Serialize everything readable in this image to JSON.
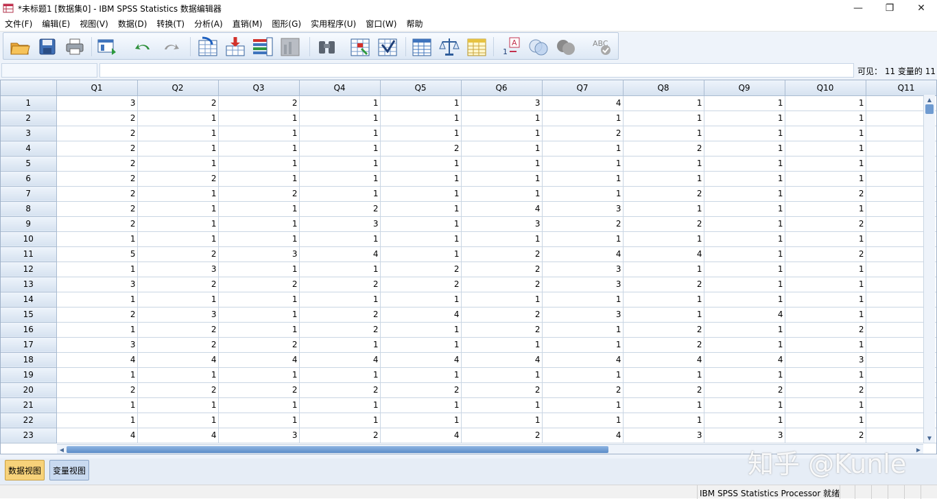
{
  "window": {
    "title": "*未标题1 [数据集0] - IBM SPSS Statistics 数据编辑器",
    "minimize": "—",
    "maximize": "❐",
    "close": "✕"
  },
  "menu": [
    "文件(F)",
    "编辑(E)",
    "视图(V)",
    "数据(D)",
    "转换(T)",
    "分析(A)",
    "直销(M)",
    "图形(G)",
    "实用程序(U)",
    "窗口(W)",
    "帮助"
  ],
  "toolbar": {
    "icons": [
      "open-icon",
      "save-icon",
      "print-icon",
      "dialog-recall-icon",
      "undo-icon",
      "redo-icon",
      "goto-case-icon",
      "goto-variable-icon",
      "variables-icon",
      "chart-builder-icon",
      "find-icon",
      "insert-cases-icon",
      "insert-variable-icon",
      "split-file-icon",
      "weight-cases-icon",
      "select-cases-icon",
      "value-labels-icon",
      "use-sets-icon",
      "show-all-variables-icon",
      "spell-check-icon"
    ]
  },
  "editrow": {
    "visible": "可见： 11 变量的 11"
  },
  "grid": {
    "columns": [
      "Q1",
      "Q2",
      "Q3",
      "Q4",
      "Q5",
      "Q6",
      "Q7",
      "Q8",
      "Q9",
      "Q10",
      "Q11"
    ],
    "rows": [
      {
        "n": "1",
        "v": [
          "3",
          "2",
          "2",
          "1",
          "1",
          "3",
          "4",
          "1",
          "1",
          "1",
          ""
        ]
      },
      {
        "n": "2",
        "v": [
          "2",
          "1",
          "1",
          "1",
          "1",
          "1",
          "1",
          "1",
          "1",
          "1",
          ""
        ]
      },
      {
        "n": "3",
        "v": [
          "2",
          "1",
          "1",
          "1",
          "1",
          "1",
          "2",
          "1",
          "1",
          "1",
          ""
        ]
      },
      {
        "n": "4",
        "v": [
          "2",
          "1",
          "1",
          "1",
          "2",
          "1",
          "1",
          "2",
          "1",
          "1",
          ""
        ]
      },
      {
        "n": "5",
        "v": [
          "2",
          "1",
          "1",
          "1",
          "1",
          "1",
          "1",
          "1",
          "1",
          "1",
          ""
        ]
      },
      {
        "n": "6",
        "v": [
          "2",
          "2",
          "1",
          "1",
          "1",
          "1",
          "1",
          "1",
          "1",
          "1",
          ""
        ]
      },
      {
        "n": "7",
        "v": [
          "2",
          "1",
          "2",
          "1",
          "1",
          "1",
          "1",
          "2",
          "1",
          "2",
          ""
        ]
      },
      {
        "n": "8",
        "v": [
          "2",
          "1",
          "1",
          "2",
          "1",
          "4",
          "3",
          "1",
          "1",
          "1",
          ""
        ]
      },
      {
        "n": "9",
        "v": [
          "2",
          "1",
          "1",
          "3",
          "1",
          "3",
          "2",
          "2",
          "1",
          "2",
          ""
        ]
      },
      {
        "n": "10",
        "v": [
          "1",
          "1",
          "1",
          "1",
          "1",
          "1",
          "1",
          "1",
          "1",
          "1",
          ""
        ]
      },
      {
        "n": "11",
        "v": [
          "5",
          "2",
          "3",
          "4",
          "1",
          "2",
          "4",
          "4",
          "1",
          "2",
          ""
        ]
      },
      {
        "n": "12",
        "v": [
          "1",
          "3",
          "1",
          "1",
          "2",
          "2",
          "3",
          "1",
          "1",
          "1",
          ""
        ]
      },
      {
        "n": "13",
        "v": [
          "3",
          "2",
          "2",
          "2",
          "2",
          "2",
          "3",
          "2",
          "1",
          "1",
          ""
        ]
      },
      {
        "n": "14",
        "v": [
          "1",
          "1",
          "1",
          "1",
          "1",
          "1",
          "1",
          "1",
          "1",
          "1",
          ""
        ]
      },
      {
        "n": "15",
        "v": [
          "2",
          "3",
          "1",
          "2",
          "4",
          "2",
          "3",
          "1",
          "4",
          "1",
          ""
        ]
      },
      {
        "n": "16",
        "v": [
          "1",
          "2",
          "1",
          "2",
          "1",
          "2",
          "1",
          "2",
          "1",
          "2",
          ""
        ]
      },
      {
        "n": "17",
        "v": [
          "3",
          "2",
          "2",
          "1",
          "1",
          "1",
          "1",
          "2",
          "1",
          "1",
          ""
        ]
      },
      {
        "n": "18",
        "v": [
          "4",
          "4",
          "4",
          "4",
          "4",
          "4",
          "4",
          "4",
          "4",
          "3",
          ""
        ]
      },
      {
        "n": "19",
        "v": [
          "1",
          "1",
          "1",
          "1",
          "1",
          "1",
          "1",
          "1",
          "1",
          "1",
          ""
        ]
      },
      {
        "n": "20",
        "v": [
          "2",
          "2",
          "2",
          "2",
          "2",
          "2",
          "2",
          "2",
          "2",
          "2",
          ""
        ]
      },
      {
        "n": "21",
        "v": [
          "1",
          "1",
          "1",
          "1",
          "1",
          "1",
          "1",
          "1",
          "1",
          "1",
          ""
        ]
      },
      {
        "n": "22",
        "v": [
          "1",
          "1",
          "1",
          "1",
          "1",
          "1",
          "1",
          "1",
          "1",
          "1",
          ""
        ]
      },
      {
        "n": "23",
        "v": [
          "4",
          "4",
          "3",
          "2",
          "4",
          "2",
          "4",
          "3",
          "3",
          "2",
          ""
        ]
      }
    ]
  },
  "tabs": {
    "data_view": "数据视图",
    "variable_view": "变量视图"
  },
  "status": {
    "processor": "IBM SPSS Statistics Processor 就绪"
  },
  "watermark": "知乎 @Kunle"
}
